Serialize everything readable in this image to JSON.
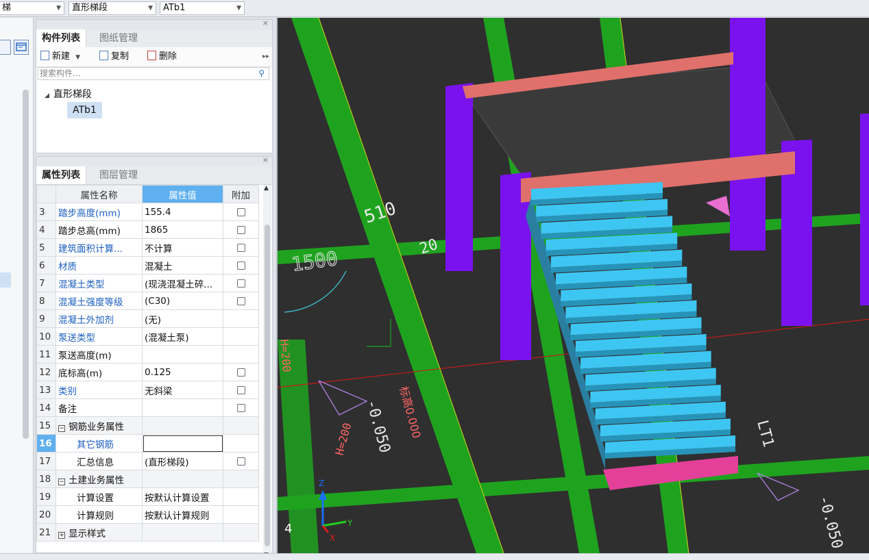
{
  "topbar": {
    "dropdown_left": "梯",
    "dropdown_type": "直形梯段",
    "dropdown_name": "ATb1"
  },
  "component_panel": {
    "tabs": [
      "构件列表",
      "图纸管理"
    ],
    "toolbar": {
      "new": "新建",
      "copy": "复制",
      "delete": "删除"
    },
    "search_placeholder": "搜索构件...",
    "tree_root": "直形梯段",
    "tree_child": "ATb1"
  },
  "property_panel": {
    "tabs": [
      "属性列表",
      "图层管理"
    ],
    "headers": {
      "name": "属性名称",
      "value": "属性值",
      "extra": "附加"
    },
    "rows": [
      {
        "num": "3",
        "name": "踏步高度(mm)",
        "value": "155.4",
        "blue": true,
        "checkbox": true
      },
      {
        "num": "4",
        "name": "踏步总高(mm)",
        "value": "1865",
        "blue": false,
        "checkbox": true
      },
      {
        "num": "5",
        "name": "建筑面积计算...",
        "value": "不计算",
        "blue": true,
        "checkbox": true
      },
      {
        "num": "6",
        "name": "材质",
        "value": "混凝土",
        "blue": true,
        "checkbox": true
      },
      {
        "num": "7",
        "name": "混凝土类型",
        "value": "(现浇混凝土碎...",
        "blue": true,
        "checkbox": true
      },
      {
        "num": "8",
        "name": "混凝土强度等级",
        "value": "(C30)",
        "blue": true,
        "checkbox": true
      },
      {
        "num": "9",
        "name": "混凝土外加剂",
        "value": "(无)",
        "blue": true,
        "checkbox": false
      },
      {
        "num": "10",
        "name": "泵送类型",
        "value": "(混凝土泵)",
        "blue": true,
        "checkbox": false
      },
      {
        "num": "11",
        "name": "泵送高度(m)",
        "value": "",
        "blue": false,
        "checkbox": false
      },
      {
        "num": "12",
        "name": "底标高(m)",
        "value": "0.125",
        "blue": false,
        "checkbox": true
      },
      {
        "num": "13",
        "name": "类别",
        "value": "无斜梁",
        "blue": true,
        "checkbox": true
      },
      {
        "num": "14",
        "name": "备注",
        "value": "",
        "blue": false,
        "checkbox": true
      },
      {
        "num": "15",
        "name": "钢筋业务属性",
        "value": "",
        "group": "minus"
      },
      {
        "num": "16",
        "name": "其它钢筋",
        "value": "",
        "blue": true,
        "child": true,
        "selected": true
      },
      {
        "num": "17",
        "name": "汇总信息",
        "value": "(直形梯段)",
        "blue": false,
        "child": true,
        "checkbox": true
      },
      {
        "num": "18",
        "name": "土建业务属性",
        "value": "",
        "group": "minus"
      },
      {
        "num": "19",
        "name": "计算设置",
        "value": "按默认计算设置",
        "blue": false,
        "child": true
      },
      {
        "num": "20",
        "name": "计算规则",
        "value": "按默认计算规则",
        "blue": false,
        "child": true
      },
      {
        "num": "21",
        "name": "显示样式",
        "value": "",
        "group": "plus"
      }
    ]
  },
  "viewport": {
    "labels": {
      "dim_510": "510",
      "dim_1500": "1500",
      "dim_20": "20",
      "elev_a": "-0.050",
      "elev_b": "-0.050",
      "elev_c": "标高0.000",
      "label_lt1": "LT1",
      "label_hz": "H=200",
      "label_hz2": "H=200",
      "axis_y": "Y",
      "axis_x": "X",
      "axis_z": "Z",
      "view_num": "4"
    },
    "colors": {
      "background": "#2f2f2f",
      "stairs": "#3ec6f2",
      "column": "#7a12ef",
      "beam": "#e0706b",
      "landing": "#e4409a",
      "grid_green": "#1fa31f"
    }
  }
}
